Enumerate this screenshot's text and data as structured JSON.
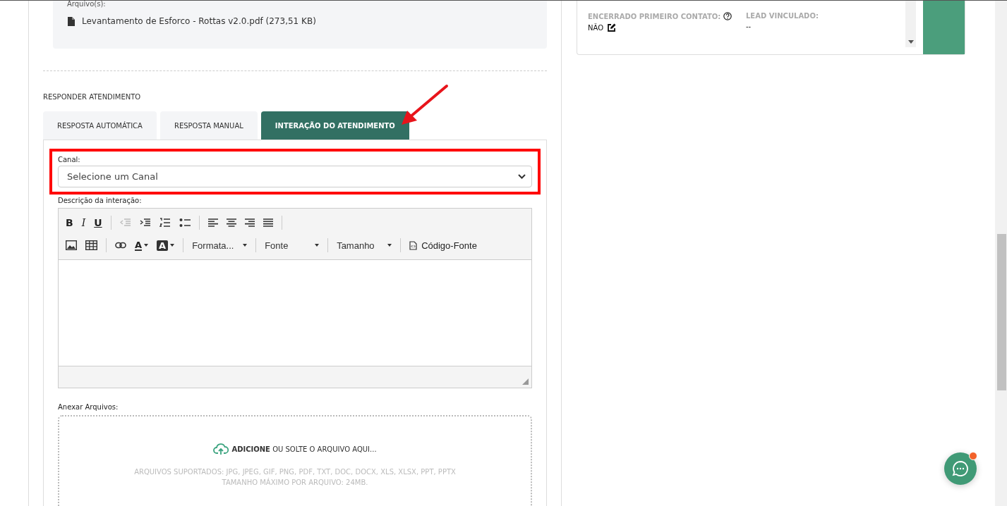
{
  "attachments": {
    "label": "Arquivo(s):",
    "files": [
      "Levantamento de Esforco - Rottas v2.0.pdf (273,51 KB)"
    ]
  },
  "reply": {
    "title": "RESPONDER ATENDIMENTO",
    "tabs": [
      {
        "label": "RESPOSTA AUTOMÁTICA",
        "selected": false
      },
      {
        "label": "RESPOSTA MANUAL",
        "selected": false
      },
      {
        "label": "INTERAÇÃO DO ATENDIMENTO",
        "selected": true
      }
    ],
    "channel": {
      "label": "Canal:",
      "placeholder": "Selecione um Canal"
    },
    "description": {
      "label": "Descrição da interação:",
      "style_buttons": [
        "B",
        "I",
        "U"
      ],
      "color_buttons": [
        "A",
        "A"
      ],
      "dropdowns": [
        "Formata...",
        "Fonte",
        "Tamanho"
      ],
      "source_button": "Código-Fonte"
    },
    "attach": {
      "label": "Anexar Arquivos:",
      "prompt": "**ADICIONE** OU SOLTE O ARQUIVO AQUI...",
      "formats": "ARQUIVOS SUPORTADOS: JPG, JPEG, GIF, PNG, PDF, TXT, DOC, DOCX, XLS, XLSX, PPT, PPTX",
      "max_size": "TAMANHO MÁXIMO POR ARQUIVO: 24MB."
    }
  },
  "details": {
    "fields": [
      {
        "label": "ENCERRADO PRIMEIRO CONTATO:",
        "value": "NÃO",
        "help": true,
        "editable": true
      },
      {
        "label": "LEAD VINCULADO:",
        "value": "--",
        "help": false,
        "editable": false
      }
    ]
  }
}
